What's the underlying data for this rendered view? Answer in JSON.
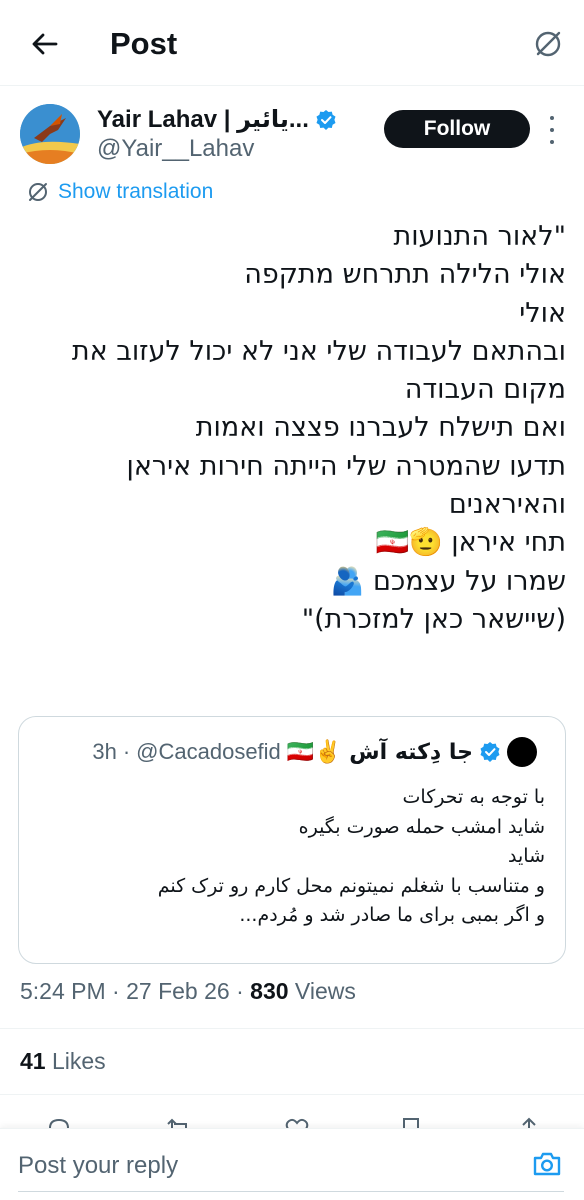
{
  "header": {
    "title": "Post",
    "back_icon": "arrow-left-icon",
    "translate_icon": "translate-icon"
  },
  "author": {
    "display_name": "Yair Lahav | يائير...",
    "handle": "@Yair__Lahav",
    "verified": true,
    "follow_label": "Follow"
  },
  "translation": {
    "label": "Show translation"
  },
  "post": {
    "lines": [
      "\"לאור התנועות",
      "אולי הלילה תתרחש מתקפה",
      "אולי",
      "ובהתאם לעבודה שלי אני לא יכול לעזוב את",
      "מקום העבודה",
      "ואם תישלח לעברנו פצצה ואמות",
      "תדעו שהמטרה שלי הייתה חירות איראן",
      "והאיראנים",
      "תחי איראן 🫡🇮🇷",
      "שמרו על עצמכם 🫂",
      "(שיישאר כאן למזכרת)\""
    ]
  },
  "quote": {
    "name": "جا دِکته آش ✌️🇮🇷",
    "handle": "@Cacadosefid",
    "time": "3h",
    "verified": true,
    "lines": [
      "با توجه به تحرکات",
      "شاید امشب حمله صورت بگیره",
      "شاید",
      "و متناسب با شغلم نمیتونم محل کارم رو ترک کنم",
      "و اگر بمبی برای ما صادر شد و مُردم..."
    ]
  },
  "meta": {
    "time": "5:24 PM",
    "date": "27 Feb 26",
    "views_count": "830",
    "views_label": "Views"
  },
  "likes": {
    "count": "41",
    "label": "Likes"
  },
  "reply": {
    "placeholder": "Post your reply",
    "camera_icon": "camera-icon"
  },
  "colors": {
    "accent": "#1d9bf0",
    "text": "#0f1419",
    "muted": "#536471",
    "border": "#cfd9de"
  }
}
